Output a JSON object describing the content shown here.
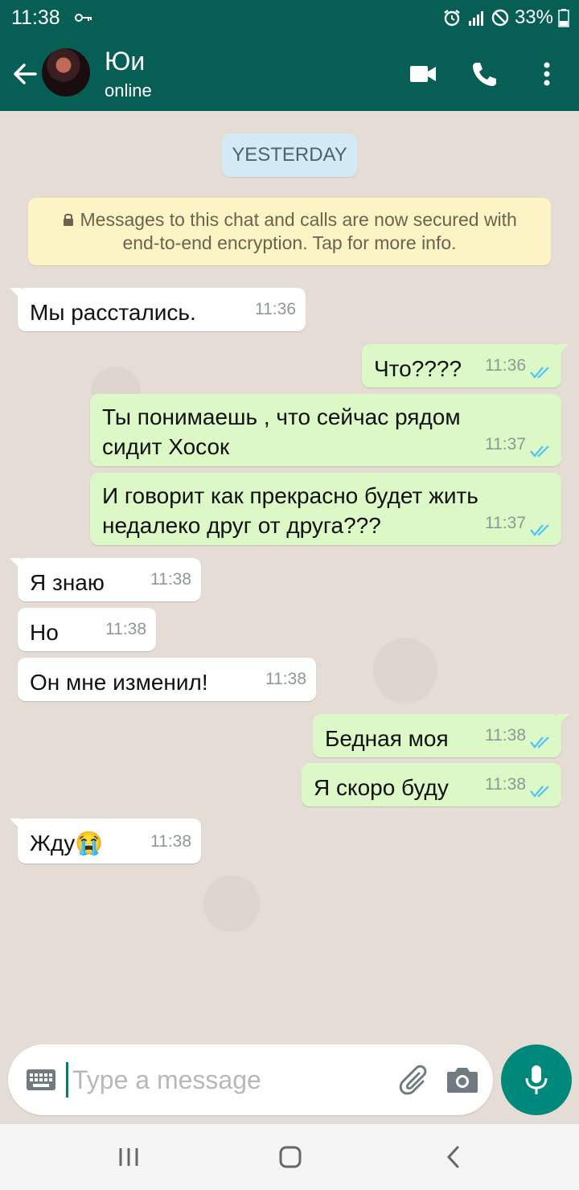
{
  "status_bar": {
    "time": "11:38",
    "battery": "33%"
  },
  "header": {
    "name": "Юи",
    "status": "online"
  },
  "chat": {
    "date_chip": "YESTERDAY",
    "notice_line1": "Messages to this chat and calls are now secured with",
    "notice_line2": "end-to-end encryption. Tap for more info.",
    "messages": [
      {
        "dir": "in",
        "text": "Мы расстались.",
        "time": "11:36"
      },
      {
        "dir": "out",
        "text": "Что????",
        "time": "11:36"
      },
      {
        "dir": "out",
        "line1": "Ты понимаешь , что сейчас рядом",
        "line2": "сидит Хосок",
        "time": "11:37"
      },
      {
        "dir": "out",
        "line1": "И говорит как прекрасно будет жить",
        "line2": "недалеко друг от друга???",
        "time": "11:37"
      },
      {
        "dir": "in",
        "text": "Я знаю",
        "time": "11:38"
      },
      {
        "dir": "in",
        "text": "Но",
        "time": "11:38"
      },
      {
        "dir": "in",
        "text": "Он мне изменил!",
        "time": "11:38"
      },
      {
        "dir": "out",
        "text": "Бедная моя",
        "time": "11:38"
      },
      {
        "dir": "out",
        "text": "Я скоро буду",
        "time": "11:38"
      },
      {
        "dir": "in",
        "text": "Жду",
        "emoji": "😭",
        "time": "11:38"
      }
    ]
  },
  "composer": {
    "placeholder": "Type a message"
  },
  "colors": {
    "header": "#075e54",
    "outgoing": "#dcf8c6",
    "incoming": "#ffffff",
    "accent": "#00897b",
    "tick": "#4fc3f7"
  }
}
